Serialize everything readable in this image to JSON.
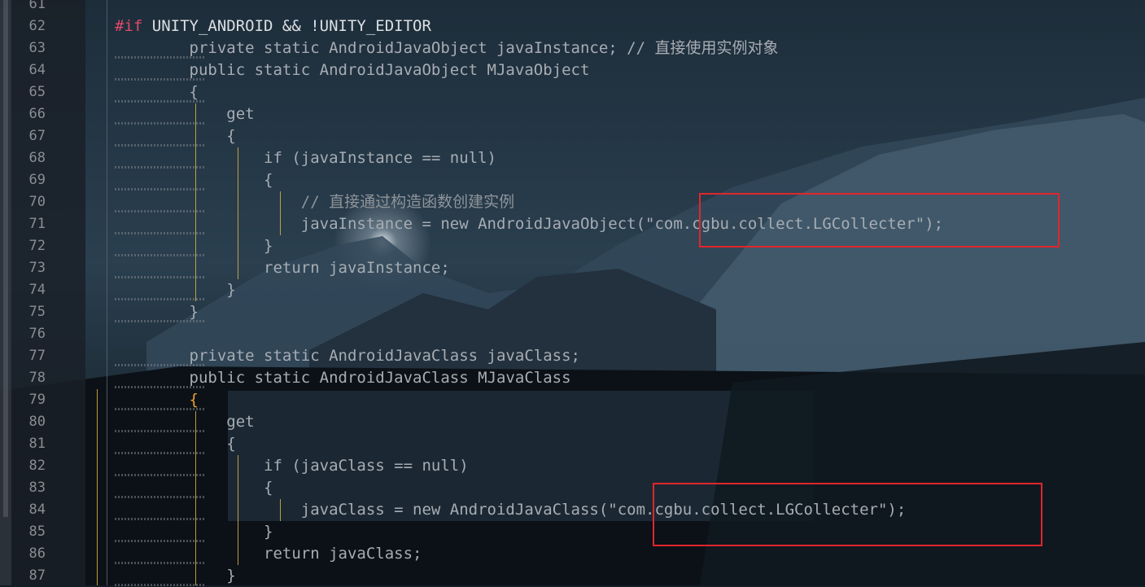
{
  "editor": {
    "lines": [
      {
        "num": "61",
        "text": ""
      },
      {
        "num": "62",
        "parts": [
          {
            "t": "#if",
            "c": "kw-dir"
          },
          {
            "t": " UNITY_ANDROID && !UNITY_EDITOR",
            "c": "plain-bright"
          }
        ]
      },
      {
        "num": "63",
        "parts": [
          {
            "t": "        private static AndroidJavaObject javaInstance; // 直接使用实例对象",
            "c": "dim"
          }
        ]
      },
      {
        "num": "64",
        "parts": [
          {
            "t": "        public static AndroidJavaObject MJavaObject",
            "c": "dim"
          }
        ]
      },
      {
        "num": "65",
        "parts": [
          {
            "t": "        {",
            "c": "dim"
          }
        ]
      },
      {
        "num": "66",
        "parts": [
          {
            "t": "            get",
            "c": "dim"
          }
        ]
      },
      {
        "num": "67",
        "parts": [
          {
            "t": "            {",
            "c": "dim"
          }
        ]
      },
      {
        "num": "68",
        "parts": [
          {
            "t": "                if (javaInstance == null)",
            "c": "dim"
          }
        ]
      },
      {
        "num": "69",
        "parts": [
          {
            "t": "                {",
            "c": "dim"
          }
        ]
      },
      {
        "num": "70",
        "parts": [
          {
            "t": "                    // 直接通过构造函数创建实例",
            "c": "cmt"
          }
        ]
      },
      {
        "num": "71",
        "parts": [
          {
            "t": "                    javaInstance = new AndroidJavaObject(\"com.cgbu.collect.LGCollecter\");",
            "c": "dim"
          }
        ]
      },
      {
        "num": "72",
        "parts": [
          {
            "t": "                }",
            "c": "dim"
          }
        ]
      },
      {
        "num": "73",
        "parts": [
          {
            "t": "                return javaInstance;",
            "c": "dim"
          }
        ]
      },
      {
        "num": "74",
        "parts": [
          {
            "t": "            }",
            "c": "dim"
          }
        ]
      },
      {
        "num": "75",
        "parts": [
          {
            "t": "        }",
            "c": "dim"
          }
        ]
      },
      {
        "num": "76",
        "text": ""
      },
      {
        "num": "77",
        "parts": [
          {
            "t": "        private static AndroidJavaClass javaClass;",
            "c": "dim"
          }
        ]
      },
      {
        "num": "78",
        "parts": [
          {
            "t": "        public static AndroidJavaClass MJavaClass",
            "c": "dim"
          }
        ]
      },
      {
        "num": "79",
        "parts": [
          {
            "t": "        {",
            "c": "brace-hl"
          }
        ]
      },
      {
        "num": "80",
        "parts": [
          {
            "t": "            get",
            "c": "dim"
          }
        ]
      },
      {
        "num": "81",
        "parts": [
          {
            "t": "            {",
            "c": "dim"
          }
        ]
      },
      {
        "num": "82",
        "parts": [
          {
            "t": "                if (javaClass == null)",
            "c": "dim"
          }
        ]
      },
      {
        "num": "83",
        "parts": [
          {
            "t": "                {",
            "c": "dim"
          }
        ]
      },
      {
        "num": "84",
        "parts": [
          {
            "t": "                    javaClass = new AndroidJavaClass(\"com.cgbu.collect.LGCollecter\");",
            "c": "dim"
          }
        ]
      },
      {
        "num": "85",
        "parts": [
          {
            "t": "                }",
            "c": "dim"
          }
        ]
      },
      {
        "num": "86",
        "parts": [
          {
            "t": "                return javaClass;",
            "c": "dim"
          }
        ]
      },
      {
        "num": "87",
        "parts": [
          {
            "t": "            }",
            "c": "dim"
          }
        ]
      }
    ]
  },
  "colors": {
    "highlight_box": "#e0262c",
    "directive": "#e0496a",
    "brace_match": "#f0a030"
  }
}
